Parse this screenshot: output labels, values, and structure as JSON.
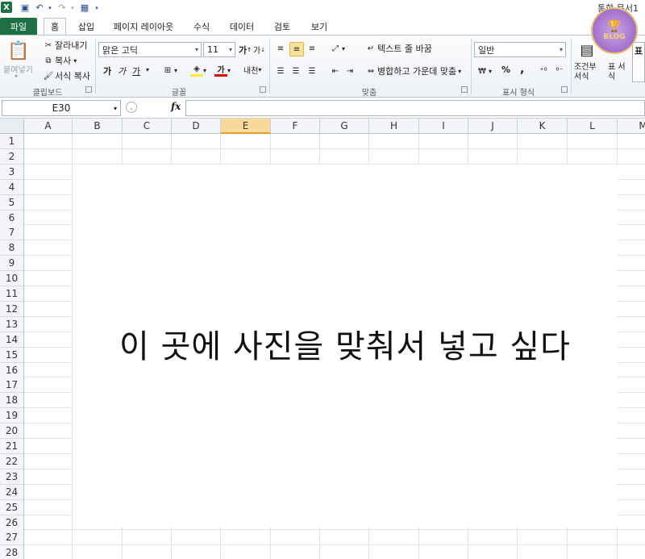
{
  "window": {
    "title": "통합 문서1"
  },
  "tabs": [
    "파일",
    "홈",
    "삽입",
    "페이지 레이아웃",
    "수식",
    "데이터",
    "검토",
    "보기"
  ],
  "ribbon": {
    "clipboard": {
      "paste": "붙여넣기",
      "cut": "잘라내기",
      "copy": "복사",
      "format_painter": "서식 복사",
      "label": "클립보드"
    },
    "font": {
      "font_name": "맑은 고딕",
      "font_size": "11",
      "bold": "가",
      "italic": "가",
      "underline": "가",
      "label": "글꼴",
      "grow": "가",
      "shrink": "가",
      "phonetic": "내천"
    },
    "alignment": {
      "wrap_text": "텍스트 줄 바꿈",
      "merge_center": "병합하고 가운데 맞춤",
      "label": "맞춤"
    },
    "number": {
      "format": "일반",
      "percent": "%",
      "comma": ",",
      "label": "표시 형식"
    },
    "styles": {
      "conditional": "조건부 서식",
      "table": "표 서식",
      "cell_style": "표"
    }
  },
  "formula_bar": {
    "name_box": "E30",
    "fx": "fx",
    "value": ""
  },
  "columns": [
    "A",
    "B",
    "C",
    "D",
    "E",
    "F",
    "G",
    "H",
    "I",
    "J",
    "K",
    "L",
    "M"
  ],
  "selected_column": "E",
  "rows": [
    "1",
    "2",
    "3",
    "4",
    "5",
    "6",
    "7",
    "8",
    "9",
    "10",
    "11",
    "12",
    "13",
    "14",
    "15",
    "16",
    "17",
    "18",
    "19",
    "20",
    "21",
    "22",
    "23",
    "24",
    "25",
    "26",
    "27",
    "28"
  ],
  "content": {
    "placeholder_text": "이 곳에 사진을 맞춰서 넣고 싶다"
  },
  "badge": {
    "text": "BLOG"
  },
  "colors": {
    "excel_green": "#1e7145",
    "selected_header": "#f9d99a",
    "grid_line": "#dde2e8"
  }
}
